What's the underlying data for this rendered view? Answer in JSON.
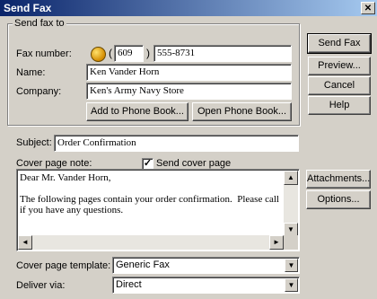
{
  "window": {
    "title": "Send Fax",
    "close_glyph": "✕"
  },
  "send_to": {
    "legend": "Send fax to",
    "fax_number_label": "Fax number:",
    "area_code": "609",
    "paren_open": "(",
    "paren_close": ")",
    "fax_number": "555-8731",
    "name_label": "Name:",
    "name_value": "Ken Vander Horn",
    "company_label": "Company:",
    "company_value": "Ken's Army Navy Store",
    "add_phone_book": "Add to Phone Book...",
    "open_phone_book": "Open Phone Book..."
  },
  "side_buttons": {
    "send": "Send Fax",
    "preview": "Preview...",
    "cancel": "Cancel",
    "help": "Help",
    "attachments": "Attachments...",
    "options": "Options..."
  },
  "subject": {
    "label": "Subject:",
    "value": "Order Confirmation"
  },
  "cover_note": {
    "label": "Cover page note:",
    "send_cover_label": "Send cover page",
    "send_cover_checked": true,
    "text": "Dear Mr. Vander Horn,\n\nThe following pages contain your order confirmation.  Please call if you have any questions."
  },
  "template": {
    "label": "Cover page template:",
    "value": "Generic Fax"
  },
  "deliver": {
    "label": "Deliver via:",
    "value": "Direct"
  },
  "icons": {
    "dropdown": "▼",
    "up": "▲",
    "down": "▼",
    "left": "◄",
    "right": "►",
    "check": "✓"
  }
}
